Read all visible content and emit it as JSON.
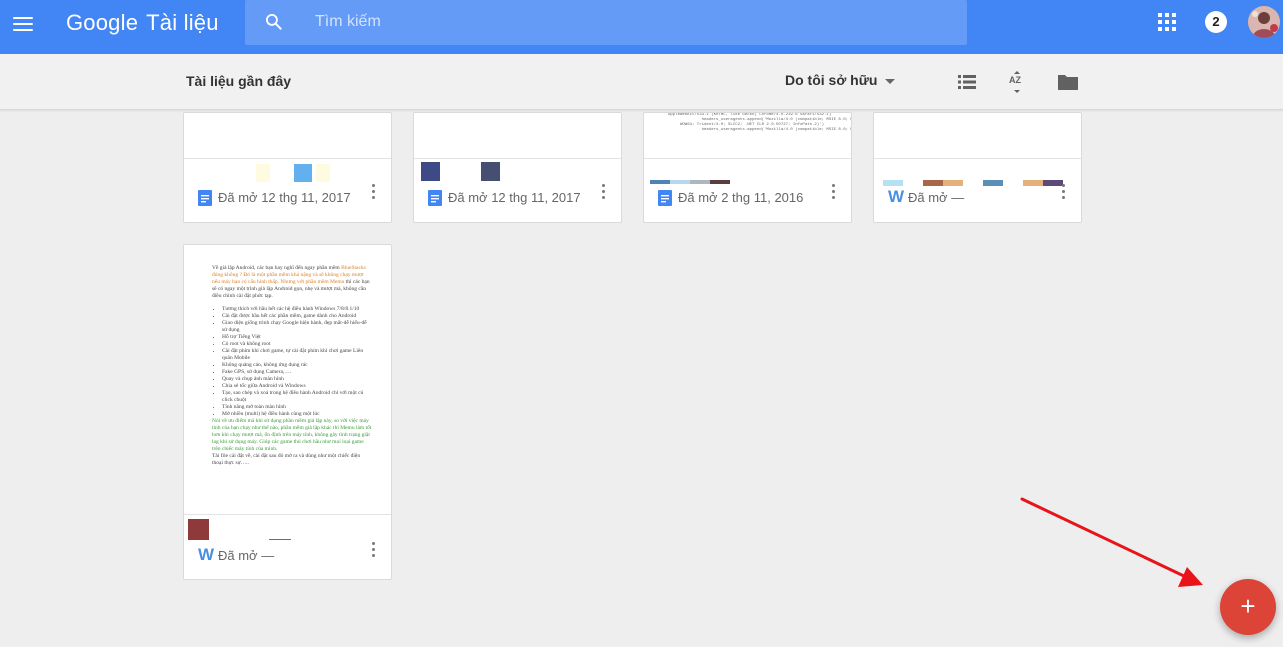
{
  "appbar": {
    "logo_google": "Google",
    "logo_product": "Tài liệu",
    "search_placeholder": "Tìm kiếm",
    "notification_count": "2"
  },
  "subbar": {
    "section_title": "Tài liệu gần đây",
    "owner_filter": "Do tôi sở hữu"
  },
  "documents": [
    {
      "type": "google-doc-icon",
      "opened": "Đã mở  12 thg 11, 2017"
    },
    {
      "type": "google-doc-icon",
      "opened": "Đã mở  12 thg 11, 2017"
    },
    {
      "type": "google-doc-icon",
      "opened": "Đã mở  2 thg 11, 2016"
    },
    {
      "type": "word-icon",
      "word_letter": "W",
      "opened": "Đã mở  —"
    },
    {
      "type": "word-icon",
      "word_letter": "W",
      "opened": "Đã mở  —"
    }
  ],
  "thumb_code_preview": "AppleWebKit/533.1 (KHTML, like Gecko) Chrome/4.0.219.6 Safari/532.1)\n              headers_useragents.append('Mozilla/4.0 (compatible; MSIE 8.0; Windows NT 6.1;\n     WOW64; Trident/4.0; SLCC2; .NET CLR 2.0.50727; InfoPath.2)')\n              headers_useragents.append('Mozilla/4.0 (compatible; MSIE 8.0; Windows NT 6.0;",
  "thumb_doc_preview": {
    "intro_1": "Về giả lập Android, các bạn hay nghĩ đến ngay phần mềm",
    "intro_2": "BlueStacks đúng không ? Đó là một phần mềm khá nặng và sẽ không chạy mượt nếu máy bạn có cấu hình thấp. Nhưng với phần mềm",
    "intro_memu": "Memu",
    "intro_3": "thì các bạn sẽ có ngay một trình giả lập Android gọn, nhẹ và mượt mà, không cần điều chỉnh cài đặt phức tạp.",
    "bullets": [
      "Tương thích với hầu hết các hệ điều hành Windows 7/8/8.1/10",
      "Cài đặt được hầu hết các phần mềm, game dành cho Android",
      "Giao diện giống trình chạy Google hiện hành, đẹp mắt-dễ hiểu-dễ sử dụng",
      "Hỗ trợ Tiếng Việt",
      "Có root và không root",
      "Cài đặt phím khi chơi game, tự cài đặt phím khi chơi game Liên quân Mobile",
      "Không quảng cáo, không ứng dụng rác",
      "Fake GPS, sử dụng Camera,….",
      "Quay và chụp ảnh màn hình",
      "Chia sẻ tốc giữa Android và Windows",
      "Tạo, sao chép và xoá trong hệ điều hành Android chỉ với một cú click chuột",
      "Tính năng mở toàn màn hình",
      "Mở nhiều (multi) hệ điều hành cùng một lúc"
    ],
    "green_text": "Nói về ưu điểm mà khi sử dụng phần mềm giả lập này, so với việc máy tính của bạn chạy như thế nào, phần mềm giả lập khác thì Memu làm tốt hơn khi chạy mượt mà, ổn định trên máy tính, không gây tình trạng giật lag khi sử dụng máy. Giúp các game thủ chơi hầu như mọi loại game trên chiếc máy tính của mình.",
    "outro": "Tải file cài đặt về, cài đặt sau đó mở ra và dùng như một chiếc điện thoại thực sự….."
  },
  "colors": {
    "appbar": "#4285f4",
    "fab": "#db4437",
    "doc_blue": "#4285f4",
    "word_blue": "#4a90e2",
    "annotation_arrow": "#e8141a"
  }
}
